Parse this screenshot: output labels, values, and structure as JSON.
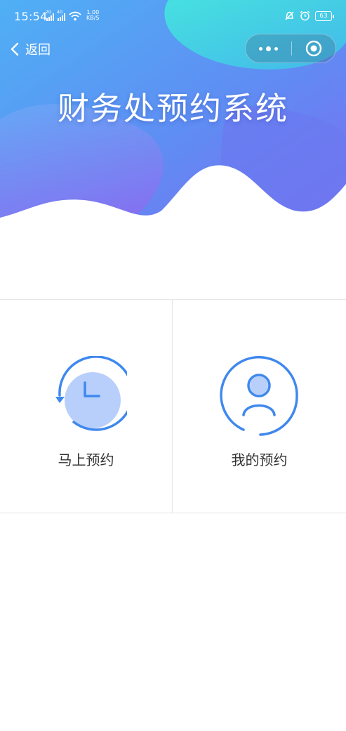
{
  "status_bar": {
    "time": "15:54",
    "signal1_tag": "2G",
    "signal2_tag": "4G",
    "net_speed_value": "1.00",
    "net_speed_unit": "KB/S",
    "battery": "63"
  },
  "nav": {
    "back_label": "返回"
  },
  "hero": {
    "title": "财务处预约系统"
  },
  "menu": {
    "book_now_label": "马上预约",
    "my_bookings_label": "我的预约"
  },
  "colors": {
    "accent_blue": "#3f88ee",
    "icon_fill": "#b8cffb",
    "hero_gradient_start": "#4fb0f5",
    "hero_gradient_end": "#7c6cf2"
  }
}
